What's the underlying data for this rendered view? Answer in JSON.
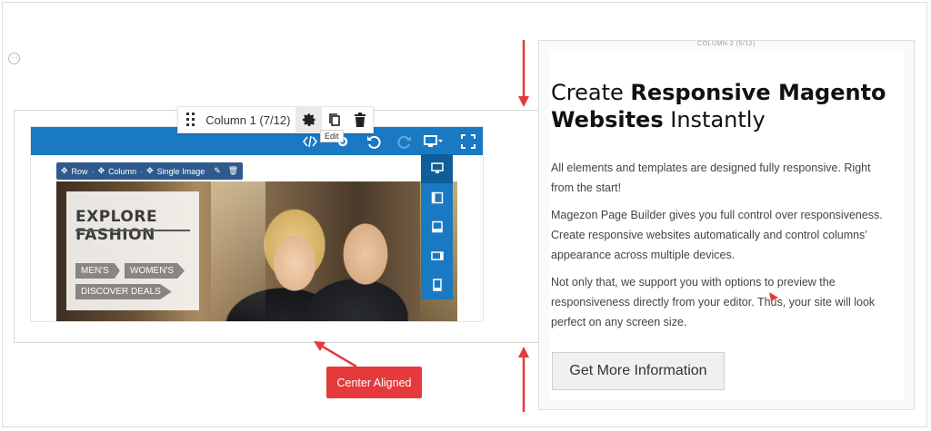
{
  "column1": {
    "label": "Column 1 (7/12)",
    "tooltip": "Edit"
  },
  "breadcrumb": {
    "row": "Row",
    "column": "Column",
    "single_image": "Single Image"
  },
  "promo": {
    "title": "EXPLORE FASHION",
    "tags": [
      "MEN'S",
      "WOMEN'S",
      "DISCOVER DEALS"
    ]
  },
  "column2": {
    "label": "COLUMN 2 (5/12)",
    "headline_part1": "Create ",
    "headline_bold": "Responsive Magento Websites",
    "headline_part2": " Instantly",
    "paragraphs": [
      "All elements and templates are designed fully responsive. Right from the start!",
      "Magezon Page Builder gives you full control over responsiveness. Create responsive websites automatically and control columns’ appearance across multiple devices.",
      "Not only that, we support you with options to preview the responsiveness directly from your editor. Thus, your site will look perfect on any screen size."
    ],
    "cta_label": "Get More Information"
  },
  "annotation": {
    "label": "Center Aligned"
  },
  "colors": {
    "editor_blue": "#1979c3",
    "annotation_red": "#e5393b"
  }
}
